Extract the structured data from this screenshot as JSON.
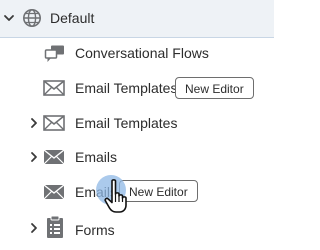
{
  "tree": {
    "root": {
      "label": "Default",
      "icon": "globe-icon",
      "expanded": true
    },
    "items": [
      {
        "label": "Conversational Flows",
        "icon": "chat-bubbles-icon",
        "expandable": false
      },
      {
        "label": "Email Templates",
        "icon": "envelope-outline-icon",
        "expandable": false,
        "button": "New Editor"
      },
      {
        "label": "Email Templates",
        "icon": "envelope-outline-icon",
        "expandable": true
      },
      {
        "label": "Emails",
        "icon": "envelope-filled-icon",
        "expandable": true
      },
      {
        "label": "Emails",
        "icon": "envelope-filled-icon",
        "expandable": false,
        "button": "New Editor"
      },
      {
        "label": "Forms",
        "icon": "clipboard-icon",
        "expandable": true
      }
    ]
  },
  "colors": {
    "root_bg": "#eef2f6",
    "root_border": "#c8d6e5",
    "icon": "#6f7174",
    "text": "#2c2c2c",
    "cursor_halo": "#8fb8e6"
  }
}
